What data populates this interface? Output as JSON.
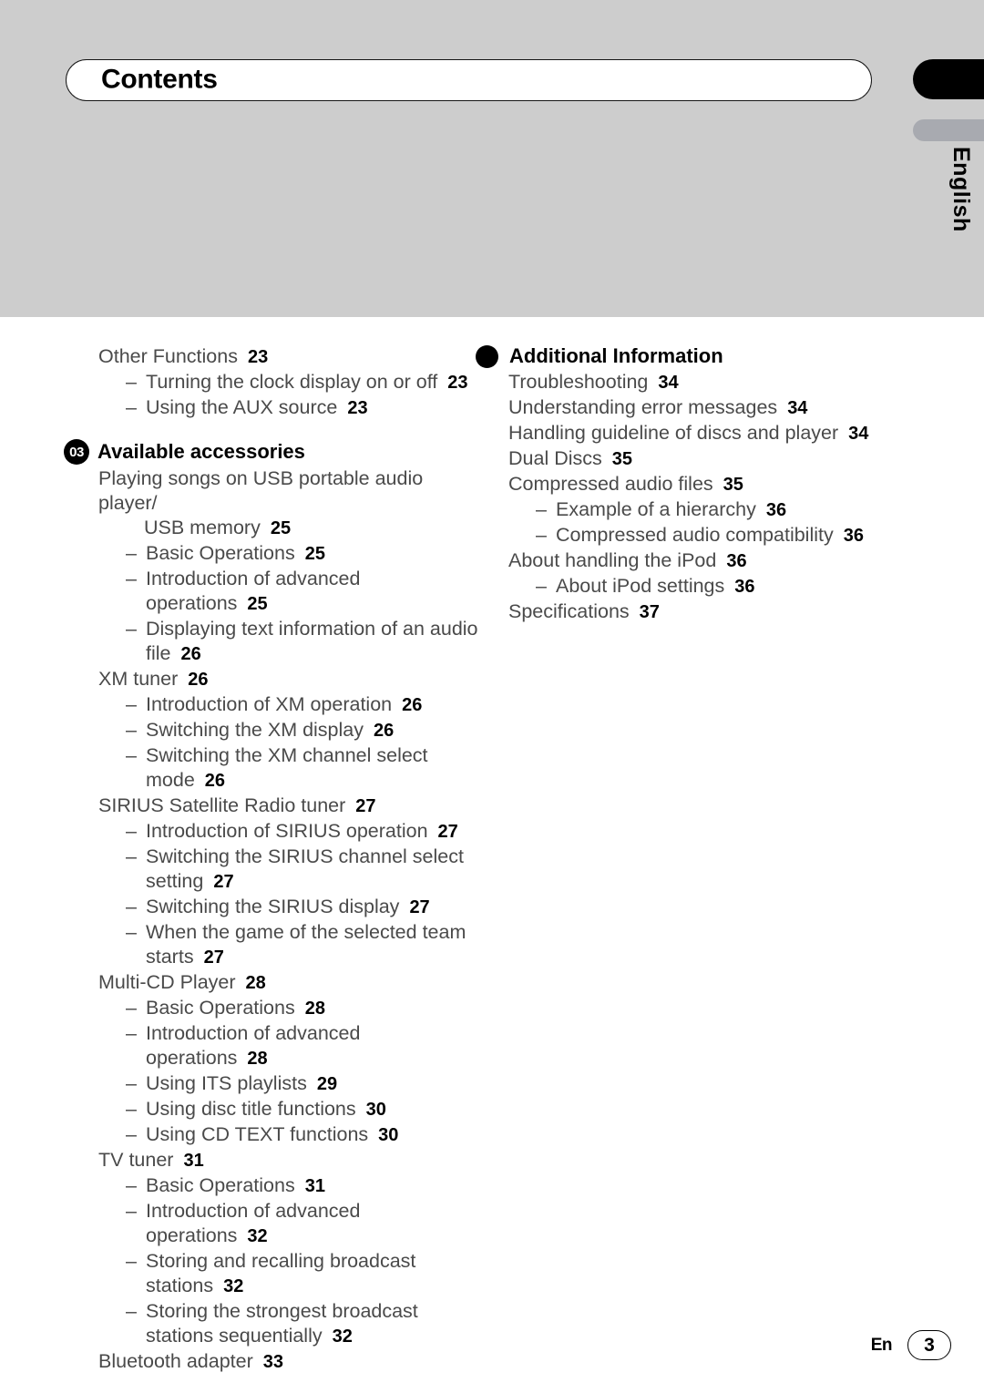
{
  "header": {
    "title": "Contents",
    "language_tab": "English"
  },
  "footer": {
    "language_code": "En",
    "page_number": "3"
  },
  "columns": {
    "left": [
      {
        "type": "entry",
        "level": 0,
        "label": "Other Functions",
        "page": "23"
      },
      {
        "type": "entry",
        "level": 1,
        "dash": "–",
        "label": "Turning the clock display on or off",
        "page": "23"
      },
      {
        "type": "entry",
        "level": 1,
        "dash": "–",
        "label": "Using the AUX source",
        "page": "23"
      },
      {
        "type": "section",
        "badge": "03",
        "badge_kind": "number",
        "title": "Available accessories"
      },
      {
        "type": "entry",
        "level": 0,
        "label": "Playing songs on USB portable audio player/",
        "page": ""
      },
      {
        "type": "entry",
        "level": "cont0",
        "label": "USB memory",
        "page": "25"
      },
      {
        "type": "entry",
        "level": 1,
        "dash": "–",
        "label": "Basic Operations",
        "page": "25"
      },
      {
        "type": "entry",
        "level": 1,
        "dash": "–",
        "label": "Introduction of advanced",
        "page": ""
      },
      {
        "type": "entry",
        "level": "cont1",
        "label": "operations",
        "page": "25"
      },
      {
        "type": "entry",
        "level": 1,
        "dash": "–",
        "label": "Displaying text information of an audio",
        "page": ""
      },
      {
        "type": "entry",
        "level": "cont1",
        "label": "file",
        "page": "26"
      },
      {
        "type": "entry",
        "level": 0,
        "label": "XM tuner",
        "page": "26"
      },
      {
        "type": "entry",
        "level": 1,
        "dash": "–",
        "label": "Introduction of XM operation",
        "page": "26"
      },
      {
        "type": "entry",
        "level": 1,
        "dash": "–",
        "label": "Switching the XM display",
        "page": "26"
      },
      {
        "type": "entry",
        "level": 1,
        "dash": "–",
        "label": "Switching the XM channel select",
        "page": ""
      },
      {
        "type": "entry",
        "level": "cont1",
        "label": "mode",
        "page": "26"
      },
      {
        "type": "entry",
        "level": 0,
        "label": "SIRIUS Satellite Radio tuner",
        "page": "27"
      },
      {
        "type": "entry",
        "level": 1,
        "dash": "–",
        "label": "Introduction of SIRIUS operation",
        "page": "27"
      },
      {
        "type": "entry",
        "level": 1,
        "dash": "–",
        "label": "Switching the SIRIUS channel select",
        "page": ""
      },
      {
        "type": "entry",
        "level": "cont1",
        "label": "setting",
        "page": "27"
      },
      {
        "type": "entry",
        "level": 1,
        "dash": "–",
        "label": "Switching the SIRIUS display",
        "page": "27"
      },
      {
        "type": "entry",
        "level": 1,
        "dash": "–",
        "label": "When the game of the selected team",
        "page": ""
      },
      {
        "type": "entry",
        "level": "cont1",
        "label": "starts",
        "page": "27"
      },
      {
        "type": "entry",
        "level": 0,
        "label": "Multi-CD Player",
        "page": "28"
      },
      {
        "type": "entry",
        "level": 1,
        "dash": "–",
        "label": "Basic Operations",
        "page": "28"
      },
      {
        "type": "entry",
        "level": 1,
        "dash": "–",
        "label": "Introduction of advanced",
        "page": ""
      },
      {
        "type": "entry",
        "level": "cont1",
        "label": "operations",
        "page": "28"
      },
      {
        "type": "entry",
        "level": 1,
        "dash": "–",
        "label": "Using ITS playlists",
        "page": "29"
      },
      {
        "type": "entry",
        "level": 1,
        "dash": "–",
        "label": "Using disc title functions",
        "page": "30"
      },
      {
        "type": "entry",
        "level": 1,
        "dash": "–",
        "label": "Using CD TEXT functions",
        "page": "30"
      },
      {
        "type": "entry",
        "level": 0,
        "label": "TV tuner",
        "page": "31"
      },
      {
        "type": "entry",
        "level": 1,
        "dash": "–",
        "label": "Basic Operations",
        "page": "31"
      },
      {
        "type": "entry",
        "level": 1,
        "dash": "–",
        "label": "Introduction of advanced",
        "page": ""
      },
      {
        "type": "entry",
        "level": "cont1",
        "label": "operations",
        "page": "32"
      },
      {
        "type": "entry",
        "level": 1,
        "dash": "–",
        "label": "Storing and recalling broadcast",
        "page": ""
      },
      {
        "type": "entry",
        "level": "cont1",
        "label": "stations",
        "page": "32"
      },
      {
        "type": "entry",
        "level": 1,
        "dash": "–",
        "label": "Storing the strongest broadcast",
        "page": ""
      },
      {
        "type": "entry",
        "level": "cont1",
        "label": "stations sequentially",
        "page": "32"
      },
      {
        "type": "entry",
        "level": 0,
        "label": "Bluetooth adapter",
        "page": "33"
      }
    ],
    "right": [
      {
        "type": "section",
        "badge": "",
        "badge_kind": "dot",
        "title": "Additional Information",
        "first": true
      },
      {
        "type": "entry",
        "level": 0,
        "label": "Troubleshooting",
        "page": "34"
      },
      {
        "type": "entry",
        "level": 0,
        "label": "Understanding error messages",
        "page": "34"
      },
      {
        "type": "entry",
        "level": 0,
        "label": "Handling guideline of discs and player",
        "page": "34"
      },
      {
        "type": "entry",
        "level": 0,
        "label": "Dual Discs",
        "page": "35"
      },
      {
        "type": "entry",
        "level": 0,
        "label": "Compressed audio files",
        "page": "35"
      },
      {
        "type": "entry",
        "level": 1,
        "dash": "–",
        "label": "Example of a hierarchy",
        "page": "36"
      },
      {
        "type": "entry",
        "level": 1,
        "dash": "–",
        "label": "Compressed audio compatibility",
        "page": "36"
      },
      {
        "type": "entry",
        "level": 0,
        "label": "About handling the iPod",
        "page": "36"
      },
      {
        "type": "entry",
        "level": 1,
        "dash": "–",
        "label": "About iPod settings",
        "page": "36"
      },
      {
        "type": "entry",
        "level": 0,
        "label": "Specifications",
        "page": "37"
      }
    ]
  },
  "colors": {
    "band_gray": "#cdcdcd",
    "tab_black": "#000000",
    "tab_gray": "#a8aab0",
    "entry_text": "#4a4a4a",
    "page_number": "#000000"
  }
}
